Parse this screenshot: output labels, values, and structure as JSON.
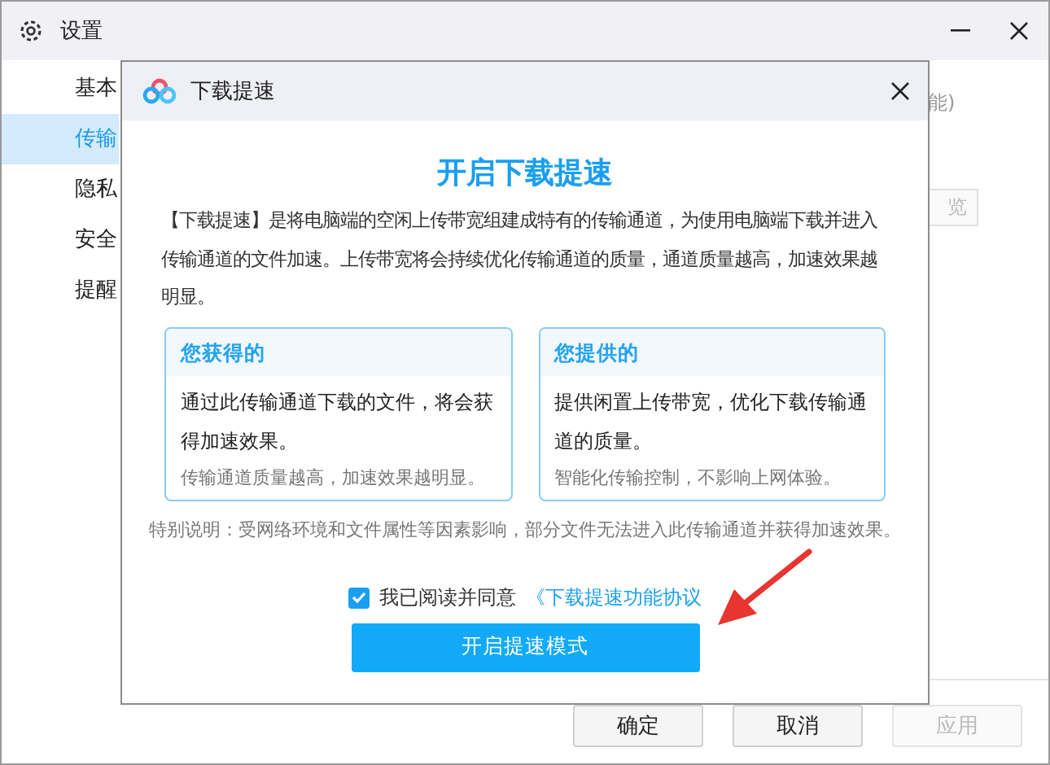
{
  "window": {
    "title": "设置"
  },
  "sidebar": {
    "items": [
      {
        "label": "基本",
        "selected": false
      },
      {
        "label": "传输",
        "selected": true
      },
      {
        "label": "隐私",
        "selected": false
      },
      {
        "label": "安全",
        "selected": false
      },
      {
        "label": "提醒",
        "selected": false
      }
    ]
  },
  "content": {
    "partial_text": "能)",
    "partial_button": "览"
  },
  "dialog": {
    "title": "下载提速",
    "heading": "开启下载提速",
    "description": "【下载提速】是将电脑端的空闲上传带宽组建成特有的传输通道，为使用电脑端下载并进入传输通道的文件加速。上传带宽将会持续优化传输通道的质量，通道质量越高，加速效果越明显。",
    "cards": [
      {
        "title": "您获得的",
        "body": "通过此传输通道下载的文件，将会获得加速效果。",
        "note": "传输通道质量越高，加速效果越明显。"
      },
      {
        "title": "您提供的",
        "body": "提供闲置上传带宽，优化下载传输通道的质量。",
        "note": "智能化传输控制，不影响上网体验。"
      }
    ],
    "special_note": "特别说明：受网络环境和文件属性等因素影响，部分文件无法进入此传输通道并获得加速效果。",
    "agreement": {
      "checked": true,
      "label": "我已阅读并同意",
      "link": "《下载提速功能协议"
    },
    "primary_button": "开启提速模式"
  },
  "footer": {
    "buttons": [
      {
        "label": "确定",
        "disabled": false
      },
      {
        "label": "取消",
        "disabled": false
      },
      {
        "label": "应用",
        "disabled": true
      }
    ]
  }
}
